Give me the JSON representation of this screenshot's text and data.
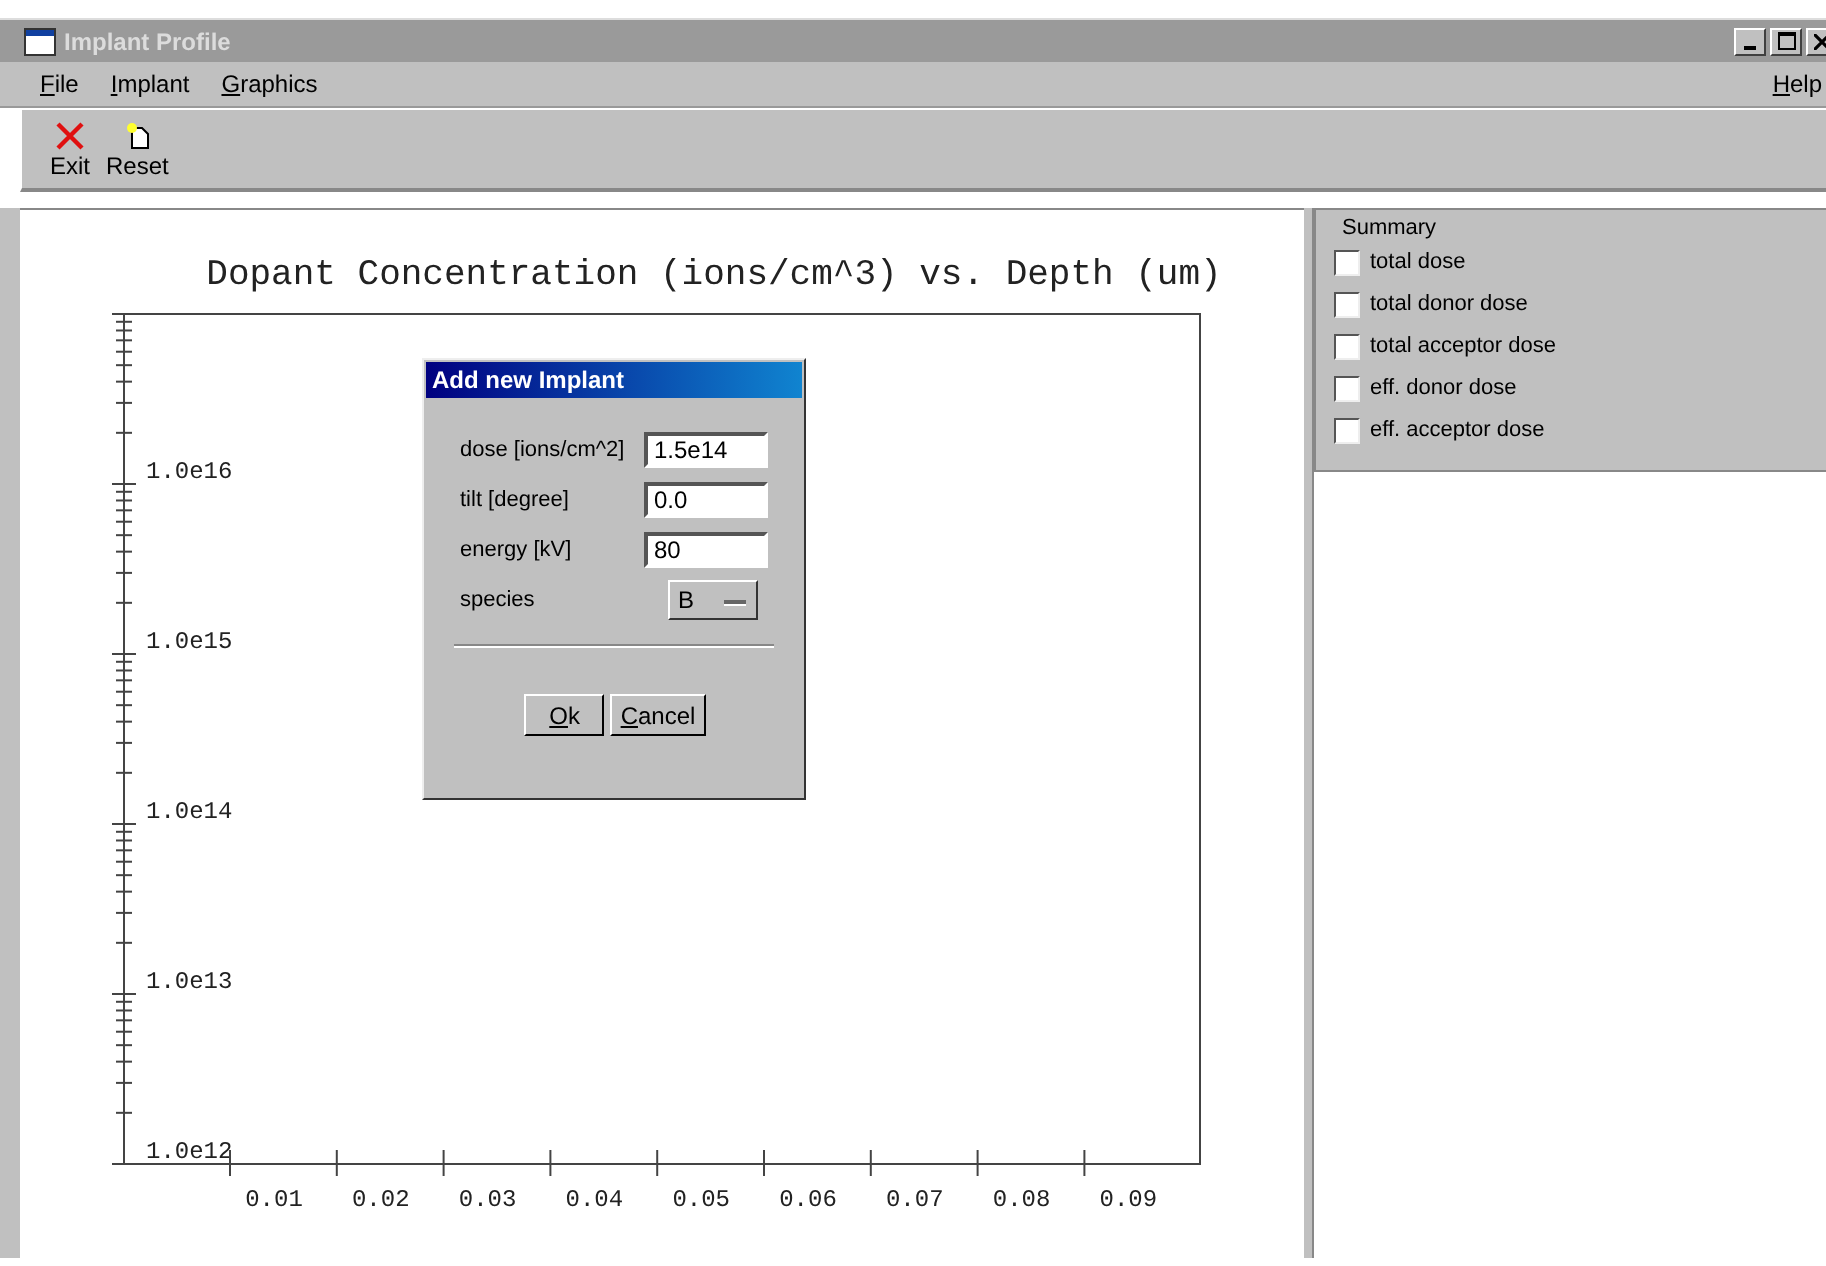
{
  "window": {
    "title": "Implant Profile"
  },
  "menu": [
    {
      "label": "File"
    },
    {
      "label": "Implant"
    },
    {
      "label": "Graphics"
    }
  ],
  "help_menu": {
    "label": "Help"
  },
  "toolbar": [
    {
      "kind": "exit",
      "label": "Exit"
    },
    {
      "kind": "reset",
      "label": "Reset"
    }
  ],
  "plot": {
    "title": "Dopant Concentration (ions/cm^3) vs. Depth (um)",
    "y_tick_labels": [
      "1.0e16",
      "1.0e15",
      "1.0e14",
      "1.0e13",
      "1.0e12"
    ],
    "x_tick_labels": [
      "0.01",
      "0.02",
      "0.03",
      "0.04",
      "0.05",
      "0.06",
      "0.07",
      "0.08",
      "0.09"
    ]
  },
  "summary": {
    "title": "Summary",
    "items": [
      {
        "label": "total dose",
        "checked": false
      },
      {
        "label": "total donor dose",
        "checked": false
      },
      {
        "label": "total acceptor dose",
        "checked": false
      },
      {
        "label": "eff. donor dose",
        "checked": false
      },
      {
        "label": "eff. acceptor dose",
        "checked": false
      }
    ]
  },
  "dialog": {
    "title": "Add new Implant",
    "fields": [
      {
        "label": "dose [ions/cm^2]",
        "value": "1.5e14"
      },
      {
        "label": "tilt [degree]",
        "value": "0.0"
      },
      {
        "label": "energy [kV]",
        "value": "80"
      }
    ],
    "species": {
      "label": "species",
      "value": "B"
    },
    "buttons": [
      {
        "label": "Ok"
      },
      {
        "label": "Cancel"
      }
    ]
  }
}
